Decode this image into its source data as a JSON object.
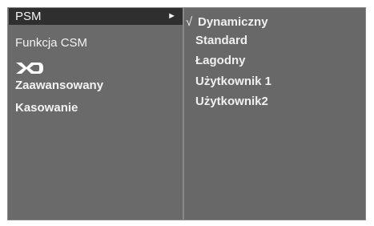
{
  "left_menu": {
    "items": [
      {
        "label": "PSM",
        "selected": true
      },
      {
        "label": "Funkcja CSM",
        "selected": false
      },
      {
        "label": "XD",
        "selected": false
      },
      {
        "label": "Zaawansowany",
        "selected": false
      },
      {
        "label": "Kasowanie",
        "selected": false
      }
    ],
    "submenu_arrow": "►"
  },
  "right_menu": {
    "check_mark": "√",
    "options": [
      {
        "label": "Dynamiczny",
        "checked": true
      },
      {
        "label": "Standard",
        "checked": false
      },
      {
        "label": "Łagodny",
        "checked": false
      },
      {
        "label": "Użytkownik 1",
        "checked": false
      },
      {
        "label": "Użytkownik2",
        "checked": false
      }
    ]
  },
  "colors": {
    "panel_bg": "#6a6a6a",
    "selected_bg": "#2f2f2f",
    "text": "#f3f3f3",
    "border": "#8a8a8a"
  }
}
